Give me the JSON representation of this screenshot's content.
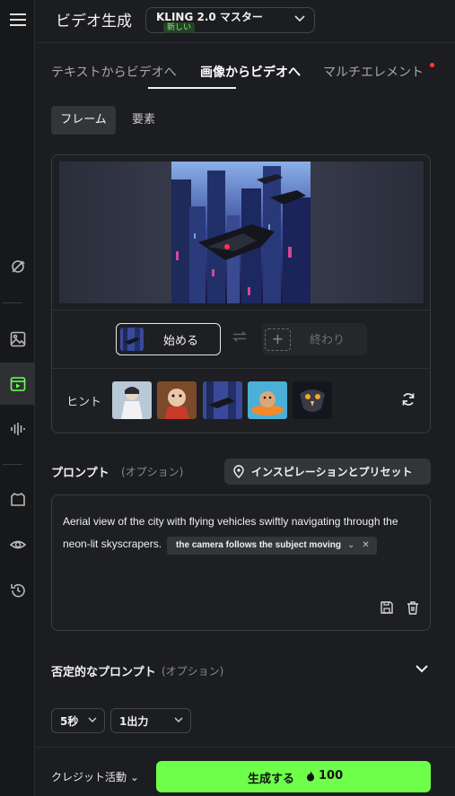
{
  "header": {
    "title": "ビデオ生成",
    "model_name": "KLING 2.0 マスター",
    "model_badge": "新しい"
  },
  "tabs": [
    {
      "label": "テキストからビデオへ",
      "active": false
    },
    {
      "label": "画像からビデオへ",
      "active": true
    },
    {
      "label": "マルチエレメント",
      "active": false
    }
  ],
  "subtabs": [
    {
      "label": "フレーム",
      "active": true
    },
    {
      "label": "要素",
      "active": false
    }
  ],
  "frames": {
    "start_label": "始める",
    "end_label": "終わり",
    "end_add_symbol": "+"
  },
  "hints": {
    "label": "ヒント",
    "thumbnails": [
      "figure-in-white",
      "hamster-in-costume",
      "city-flying-vehicles",
      "hamster-on-float",
      "eagle-portrait"
    ]
  },
  "prompt": {
    "label": "プロンプト",
    "optional": "(オプション)",
    "inspiration_button": "インスピレーションとプリセット",
    "text": "Aerial view of the city with flying vehicles swiftly navigating through the neon-lit skyscrapers.",
    "camera_chip": "the camera follows the subject moving"
  },
  "negative_prompt": {
    "label": "否定的なプロンプト",
    "optional": "(オプション)"
  },
  "settings": {
    "duration": "5秒",
    "outputs": "1出力"
  },
  "footer": {
    "credit_label": "クレジット活動",
    "generate_label": "生成する",
    "cost": "100"
  },
  "colors": {
    "accent": "#6dff4a",
    "background": "#1c1d20",
    "notification_dot": "#ff3b3b"
  }
}
